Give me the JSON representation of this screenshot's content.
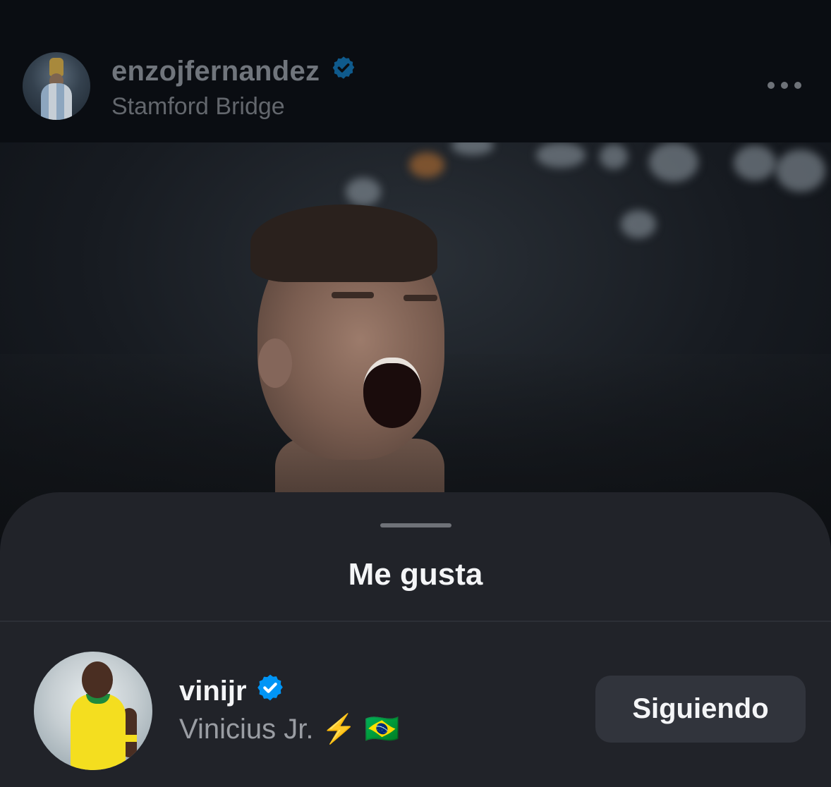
{
  "post": {
    "username": "enzojfernandez",
    "location": "Stamford Bridge",
    "verified": true
  },
  "likes_sheet": {
    "title": "Me gusta",
    "items": [
      {
        "username": "vinijr",
        "verified": true,
        "full_name": "Vinicius Jr. ⚡️ 🇧🇷",
        "follow_label": "Siguiendo"
      }
    ]
  },
  "icons": {
    "verified": "verified-badge-icon",
    "more": "more-options-icon"
  },
  "colors": {
    "verified_blue": "#0095f6",
    "verified_blue_dim": "#0f5a8c",
    "sheet_background": "#212329",
    "button_background": "#31343c"
  }
}
